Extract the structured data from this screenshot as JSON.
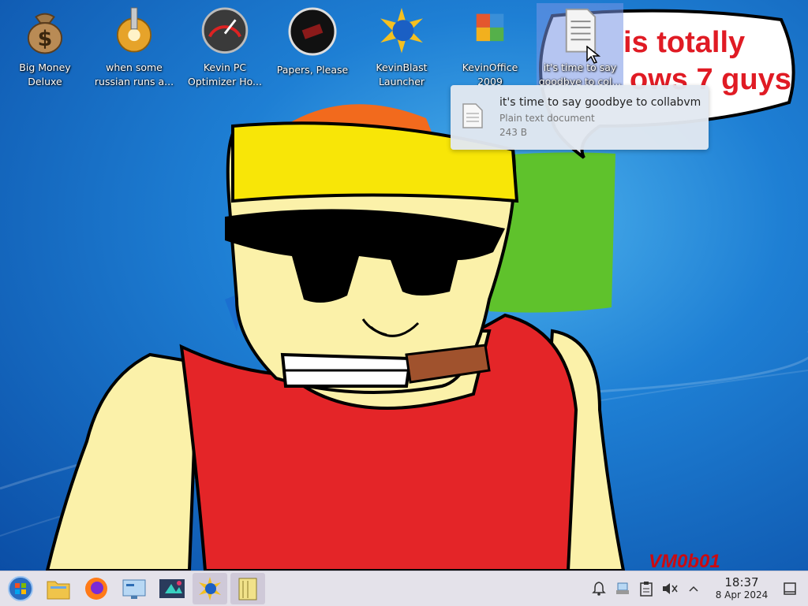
{
  "desktop": {
    "icons": [
      {
        "label": "Big Money\nDeluxe",
        "icon": "money-bag-icon"
      },
      {
        "label": "when some\nrussian runs a...",
        "icon": "gear-icon"
      },
      {
        "label": "Kevin PC\nOptimizer Ho...",
        "icon": "speedometer-icon"
      },
      {
        "label": "Papers, Please",
        "icon": "papers-please-icon"
      },
      {
        "label": "KevinBlast\nLauncher",
        "icon": "starburst-globe-icon"
      },
      {
        "label": "KevinOffice\n2009",
        "icon": "office-logo-icon"
      },
      {
        "label": "it's time to say\ngoodbye to col...",
        "icon": "text-document-icon"
      }
    ],
    "wallpaper": {
      "speech_text_line1": "is totally",
      "speech_text_line2": "ows 7 guys",
      "signature": "VM0b01"
    }
  },
  "tooltip": {
    "title": "it's time to say goodbye to collabvm",
    "type": "Plain text document",
    "size": "243 B"
  },
  "taskbar": {
    "buttons": [
      {
        "icon": "start-orb-icon"
      },
      {
        "icon": "file-manager-icon"
      },
      {
        "icon": "firefox-icon"
      },
      {
        "icon": "system-settings-icon"
      },
      {
        "icon": "discover-store-icon"
      },
      {
        "icon": "kevinblast-task-icon"
      },
      {
        "icon": "notes-task-icon"
      }
    ],
    "tray": {
      "icons": [
        "notifications-bell-icon",
        "network-icon",
        "clipboard-icon",
        "volume-muted-icon",
        "expand-tray-icon"
      ],
      "time": "18:37",
      "date": "8 Apr 2024"
    }
  },
  "colors": {
    "taskbar_bg": "#e4e2ea",
    "speech_text": "#e01b24",
    "shirt_red": "#e42528",
    "skin": "#fbf1a9",
    "bandana": "#f8e607"
  }
}
